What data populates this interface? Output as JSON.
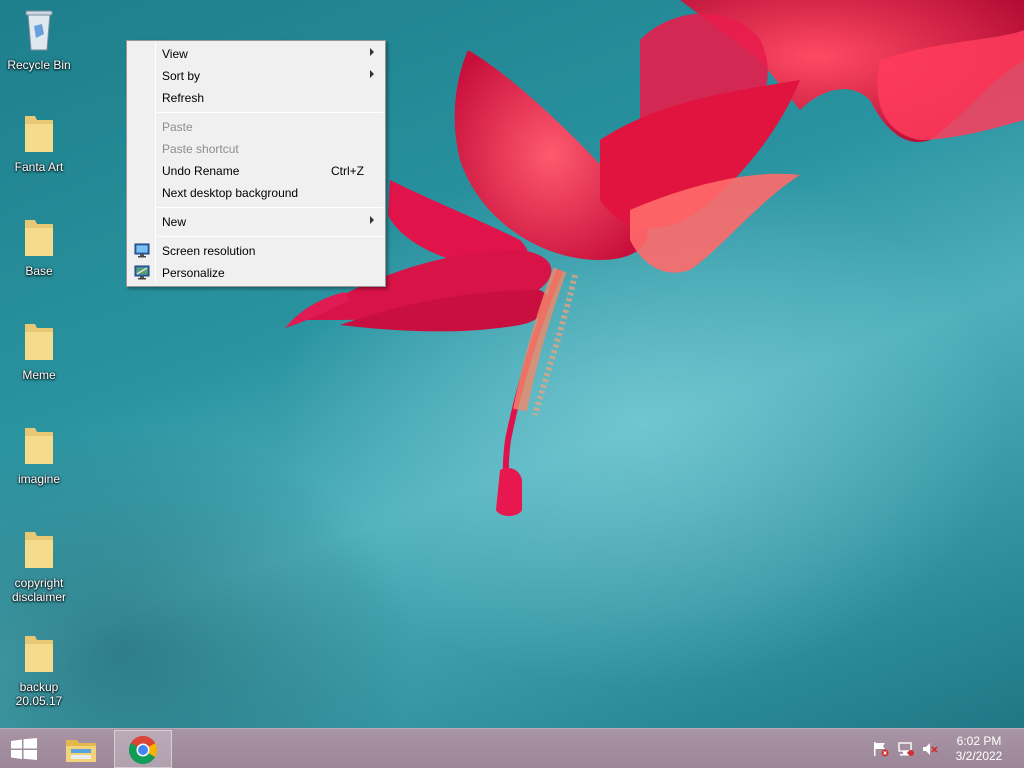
{
  "desktop": {
    "icons": [
      {
        "label": "Recycle Bin",
        "icon": "recycle-bin-icon"
      },
      {
        "label": "Fanta Art",
        "icon": "folder-icon"
      },
      {
        "label": "Base",
        "icon": "folder-icon"
      },
      {
        "label": "Meme",
        "icon": "folder-icon"
      },
      {
        "label": "imagine",
        "icon": "folder-icon"
      },
      {
        "label": "copyright disclaimer",
        "icon": "folder-icon"
      },
      {
        "label": "backup 20.05.17",
        "icon": "folder-icon"
      }
    ]
  },
  "context_menu": {
    "items": [
      {
        "label": "View",
        "submenu": true,
        "enabled": true
      },
      {
        "label": "Sort by",
        "submenu": true,
        "enabled": true
      },
      {
        "label": "Refresh",
        "enabled": true
      },
      {
        "label": "Paste",
        "enabled": false
      },
      {
        "label": "Paste shortcut",
        "enabled": false
      },
      {
        "label": "Undo Rename",
        "shortcut": "Ctrl+Z",
        "enabled": true
      },
      {
        "label": "Next desktop background",
        "enabled": true
      },
      {
        "label": "New",
        "submenu": true,
        "enabled": true
      },
      {
        "label": "Screen resolution",
        "icon": "display-icon",
        "enabled": true
      },
      {
        "label": "Personalize",
        "icon": "personalize-icon",
        "enabled": true
      }
    ]
  },
  "taskbar": {
    "apps": [
      {
        "name": "File Explorer",
        "icon": "file-explorer-icon",
        "active": false
      },
      {
        "name": "Google Chrome",
        "icon": "chrome-icon",
        "active": true
      }
    ],
    "tray": [
      "action-center-flag-icon",
      "network-icon",
      "volume-muted-icon"
    ],
    "clock": {
      "time": "6:02 PM",
      "date": "3/2/2022"
    }
  },
  "colors": {
    "desktop_teal": "#2a93a0",
    "flower_pink": "#e8174f",
    "taskbar": "#a894a5",
    "menu_bg": "#f0f0f0"
  }
}
